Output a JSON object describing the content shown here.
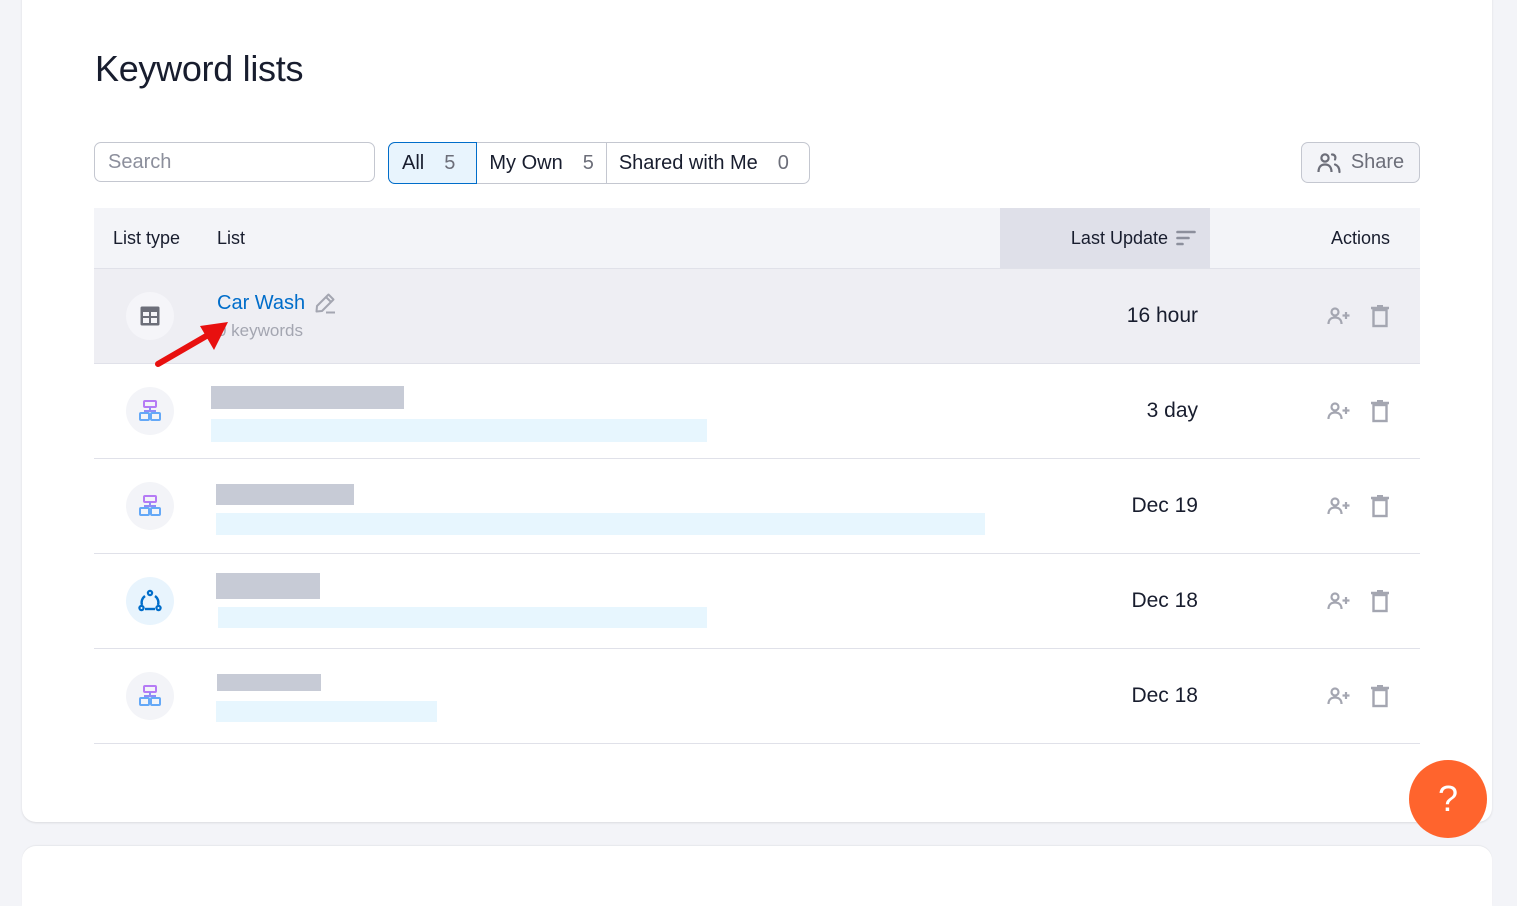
{
  "page": {
    "title": "Keyword lists"
  },
  "search": {
    "placeholder": "Search",
    "value": "",
    "icon": "search-icon"
  },
  "filter_tabs": [
    {
      "label": "All",
      "count": "5",
      "active": true
    },
    {
      "label": "My Own",
      "count": "5",
      "active": false
    },
    {
      "label": "Shared with Me",
      "count": "0",
      "active": false
    }
  ],
  "share_button": {
    "label": "Share",
    "icon": "users-icon"
  },
  "table": {
    "columns": {
      "list_type": "List type",
      "list": "List",
      "last_update": "Last Update",
      "actions": "Actions"
    },
    "sort_icon": "sort-lines-icon",
    "rows": [
      {
        "type_icon": "table-icon",
        "name": "Car Wash",
        "sub": "0 keywords",
        "last_update": "16 hour",
        "redacted": false,
        "highlighted": true
      },
      {
        "type_icon": "hierarchy-icon",
        "name": "",
        "sub": "",
        "last_update": "3 day",
        "redacted": true
      },
      {
        "type_icon": "hierarchy-icon",
        "name": "",
        "sub": "",
        "last_update": "Dec 19",
        "redacted": true
      },
      {
        "type_icon": "cluster-icon",
        "name": "",
        "sub": "",
        "last_update": "Dec 18",
        "redacted": true
      },
      {
        "type_icon": "hierarchy-icon",
        "name": "",
        "sub": "",
        "last_update": "Dec 18",
        "redacted": true
      }
    ],
    "row_actions": [
      "add-user-icon",
      "trash-icon"
    ]
  },
  "help_button": {
    "label": "?"
  },
  "colors": {
    "accent_blue": "#006dca",
    "help_orange": "#ff642d",
    "annotation_arrow": "#e8100f"
  }
}
